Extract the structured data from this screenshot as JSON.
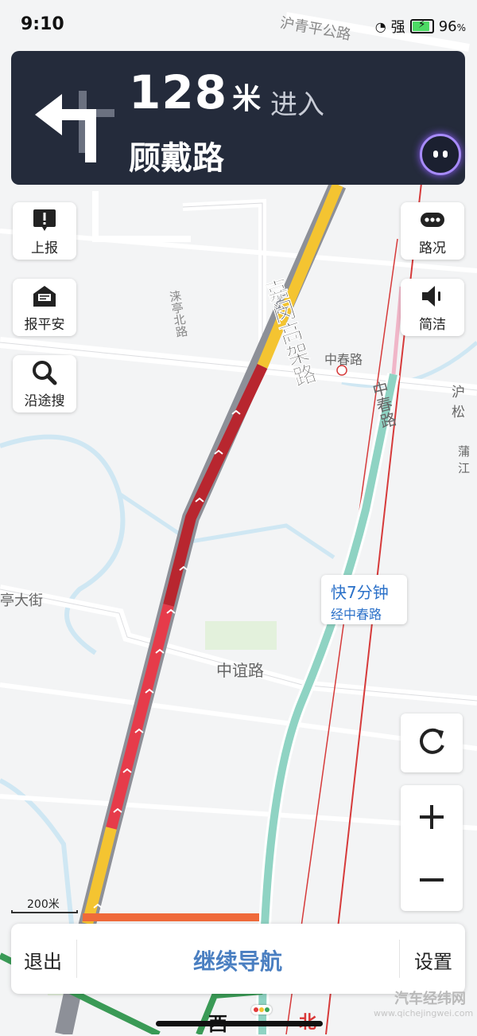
{
  "status": {
    "time": "9:10",
    "signal": "强",
    "battery": "96",
    "battery_unit": "%",
    "battery_level": 0.96
  },
  "nav": {
    "distance": "128",
    "distance_unit": "米",
    "action": "进入",
    "road": "顾戴路"
  },
  "tools": {
    "report": "上报",
    "safety": "报平安",
    "search": "沿途搜",
    "traffic": "路况",
    "simple": "简洁"
  },
  "map_labels": {
    "top_road": "沪青平公路",
    "viaduct": "嘉闵高架路",
    "zhongchun": "中春路",
    "zhongchun_v": "中春路",
    "luoting": "涞亭北路",
    "husong": "沪松",
    "pujiang": "蒲江",
    "tingda": "亭大街",
    "zhongyi": "中谊路"
  },
  "eta": {
    "main": "快7分钟",
    "sub": "经中春路"
  },
  "scale": "200米",
  "compass": {
    "west": "西",
    "north": "北"
  },
  "bottom": {
    "exit": "退出",
    "continue": "继续导航",
    "settings": "设置"
  },
  "watermark": {
    "main": "汽车经纬网",
    "sub": "www.qichejingwei.com"
  },
  "colors": {
    "panel": "#242b3b",
    "route_dark": "#b8262f",
    "route_red": "#e63b4a",
    "route_yellow": "#f4c431",
    "accent_blue": "#4a7fc1",
    "alt_route": "#8fd3c3"
  }
}
